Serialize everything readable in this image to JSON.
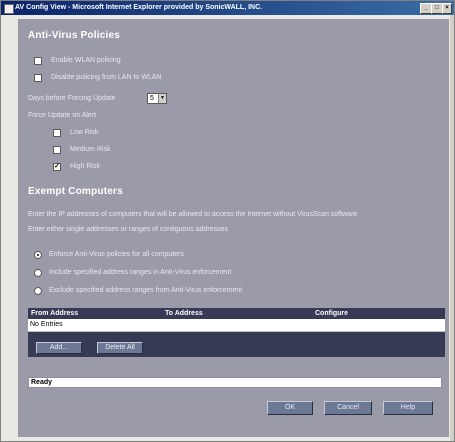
{
  "window": {
    "title": "AV Config View - Microsoft Internet Explorer provided by SonicWALL, INC.",
    "controls": [
      "_",
      "□",
      "×"
    ]
  },
  "antivirus": {
    "title": "Anti-Virus Policies",
    "enable_wlan_policing": {
      "label": "Enable WLAN policing",
      "checked": false
    },
    "disable_lan_to_wlan": {
      "label": "Disable policing from LAN to WLAN",
      "checked": false
    },
    "days_before_forcing": {
      "label": "Days before Forcing Update",
      "value": "5"
    },
    "force_update_label": "Force Update on Alert",
    "risks": [
      {
        "label": "Low Risk",
        "checked": false
      },
      {
        "label": "Medium Risk",
        "checked": false
      },
      {
        "label": "High Risk",
        "checked": true
      }
    ]
  },
  "exempt": {
    "title": "Exempt Computers",
    "desc1": "Enter the IP addresses of computers that will be allowed to access the Internet without VirusScan software",
    "desc2": "Enter either single addresses or ranges of contiguous addresses",
    "options": [
      {
        "label": "Enforce Anti-Virus policies for all computers",
        "selected": true
      },
      {
        "label": "Include specified address ranges in Anti-Virus enforcement",
        "selected": false
      },
      {
        "label": "Exclude specified address ranges from Anti-Virus enforcement",
        "selected": false
      }
    ],
    "table": {
      "headers": [
        "From Address",
        "To Address",
        "Configure"
      ],
      "empty_text": "No Entries"
    },
    "add_label": "Add...",
    "delete_all_label": "Delete All"
  },
  "status": "Ready",
  "buttons": {
    "ok": "OK",
    "cancel": "Cancel",
    "help": "Help"
  }
}
